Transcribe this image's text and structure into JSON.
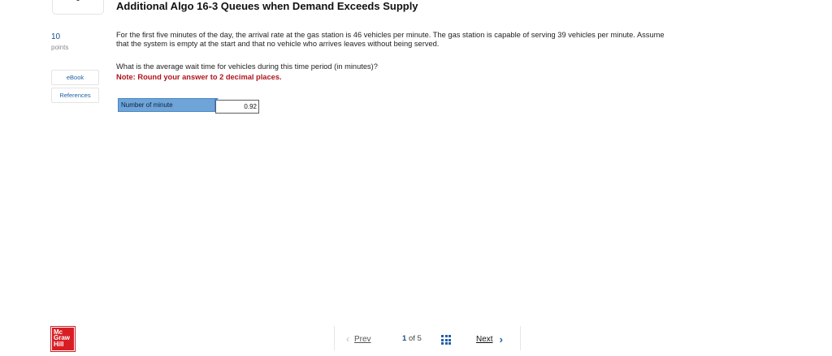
{
  "header": {
    "title": "Additional Algo 16-3 Queues when Demand Exceeds Supply"
  },
  "sidebar": {
    "points_value": "10",
    "points_label": "points",
    "ebook_label": "eBook",
    "references_label": "References"
  },
  "question": {
    "text": "For the first five minutes of the day, the arrival rate at the gas station is 46 vehicles per minute. The gas station is capable of serving 39 vehicles per minute. Assume that the system is empty at the start and that no vehicle who arrives leaves without being served.",
    "ask": "What is the average wait time for vehicles during this time period (in minutes)?",
    "note_label": "Note:",
    "note_text": "Round your answer to 2 decimal places."
  },
  "answer": {
    "label": "Number of minute",
    "value": "0.92"
  },
  "footer": {
    "logo_lines": [
      "Mc",
      "Graw",
      "Hill"
    ],
    "prev_label": "Prev",
    "current_page": "1",
    "of_label": "of",
    "total_pages": "5",
    "next_label": "Next"
  },
  "colors": {
    "title": "#111111",
    "note": "#b0141b",
    "answer_label_bg": "#6ea4d8",
    "link": "#1f5fa8",
    "logo_bg": "#d81e24"
  },
  "icons": {
    "prev": "chevron-left-icon",
    "grid": "grid-icon",
    "next": "chevron-right-icon"
  }
}
